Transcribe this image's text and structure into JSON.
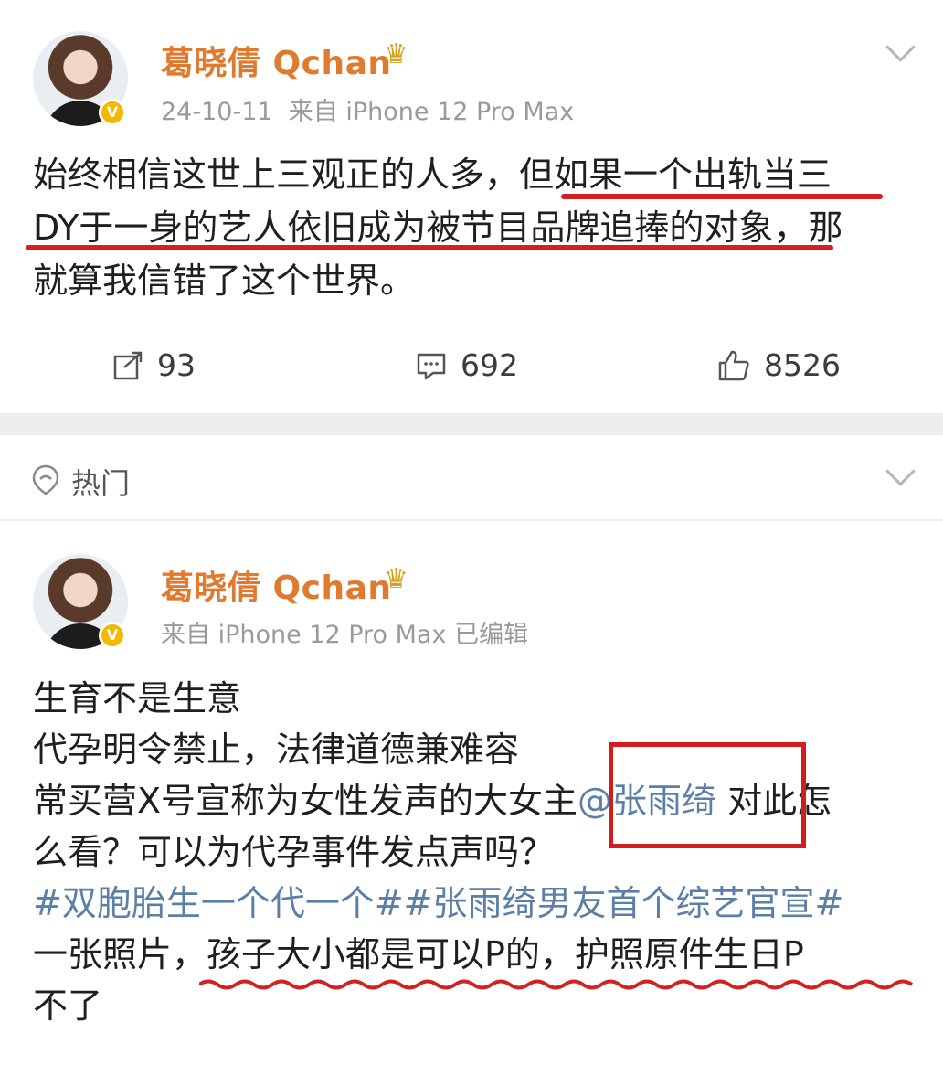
{
  "post1": {
    "user_name": "葛晓倩 Qchan",
    "crown_icon": "crown-icon",
    "timestamp": "24-10-11",
    "source": "来自 iPhone 12 Pro Max",
    "text_lines": [
      "始终相信这世上三观正的人多，但如果一个出轨当三",
      "DY于一身的艺人依旧成为被节目品牌追捧的对象，那",
      "就算我信错了这个世界。"
    ],
    "repost_count": "93",
    "comment_count": "692",
    "like_count": "8526"
  },
  "hot": {
    "label": "热门"
  },
  "post2": {
    "user_name": "葛晓倩 Qchan",
    "source": "来自 iPhone 12 Pro Max",
    "edited": "已编辑",
    "line1": "生育不是生意",
    "line2": "代孕明令禁止，法律道德兼难容",
    "line3_pre": "常买营X号宣称为女性发声的大女主",
    "mention": "@张雨绮",
    "line3_post": "对此怎",
    "line4": "么看？可以为代孕事件发点声吗？",
    "hashtags": "#双胞胎生一个代一个##张雨绮男友首个综艺官宣#",
    "line6": "一张照片，孩子大小都是可以P的，护照原件生日P",
    "line7": "不了"
  },
  "colors": {
    "name": "#e07a2f",
    "meta": "#9a9a9a",
    "link": "#5b7fa6",
    "annotation_red": "#d42020"
  }
}
